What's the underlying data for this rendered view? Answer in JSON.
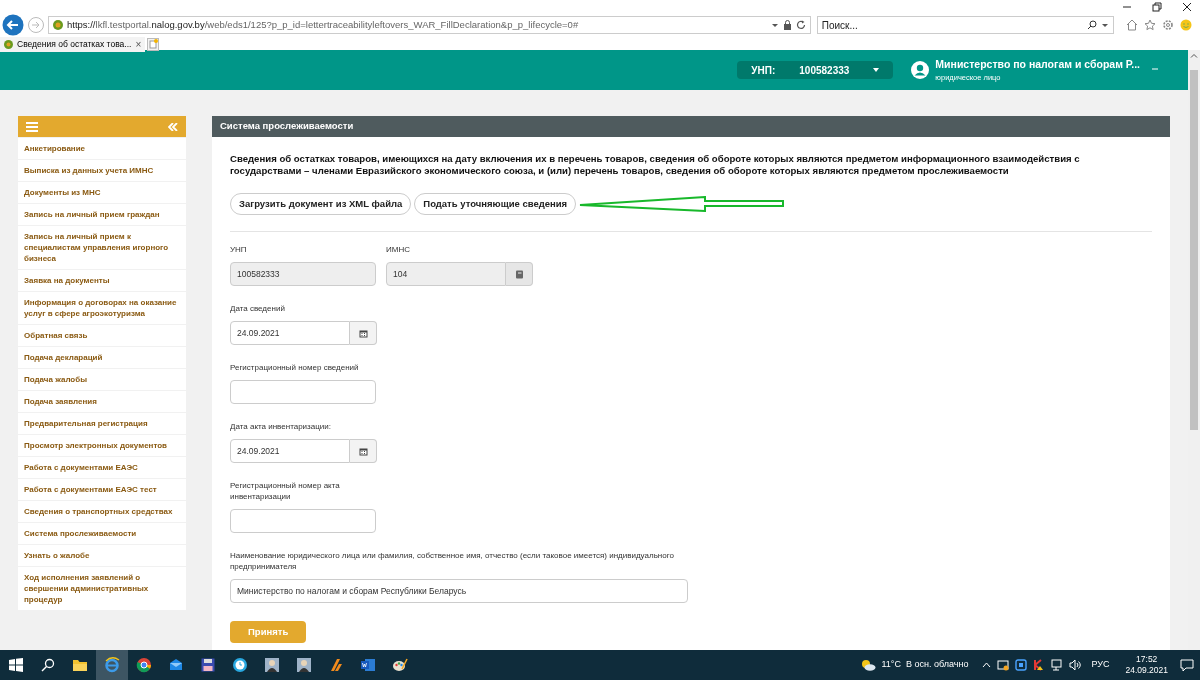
{
  "browser": {
    "url_scheme": "https://",
    "url_host_pre": "lkfl.testportal.",
    "url_host_main": "nalog.gov.by",
    "url_path": "/web/eds1/125?p_p_id=lettertraceabilityleftovers_WAR_FillDeclaration&p_p_lifecycle=0#",
    "search_placeholder": "Поиск...",
    "tab_title": "Сведения об остатках това...",
    "tab_close": "×"
  },
  "header": {
    "unp_label": "УНП:",
    "unp_value": "100582333",
    "user_name": "Министерство по налогам и сборам Р...",
    "user_role": "юридическое лицо"
  },
  "sidebar": {
    "items": [
      {
        "label": "Анкетирование",
        "selected": false
      },
      {
        "label": "Выписка из данных учета ИМНС",
        "selected": false
      },
      {
        "label": "Документы из МНС",
        "selected": false
      },
      {
        "label": "Запись на личный прием граждан",
        "selected": false
      },
      {
        "label": "Запись на личный прием к специалистам управления игорного бизнеса",
        "selected": false
      },
      {
        "label": "Заявка на документы",
        "selected": false
      },
      {
        "label": "Информация о договорах на оказание услуг в сфере агроэкотуризма",
        "selected": false
      },
      {
        "label": "Обратная связь",
        "selected": false
      },
      {
        "label": "Подача деклараций",
        "selected": false
      },
      {
        "label": "Подача жалобы",
        "selected": false
      },
      {
        "label": "Подача заявления",
        "selected": false
      },
      {
        "label": "Предварительная регистрация",
        "selected": false
      },
      {
        "label": "Просмотр электронных документов",
        "selected": false
      },
      {
        "label": "Работа с документами ЕАЭС",
        "selected": false
      },
      {
        "label": "Работа с документами ЕАЭС тест",
        "selected": false
      },
      {
        "label": "Сведения о транспортных средствах",
        "selected": false
      },
      {
        "label": "Система прослеживаемости",
        "selected": false
      },
      {
        "label": "Узнать о жалобе",
        "selected": false
      },
      {
        "label": "Ход исполнения заявлений о свершении административных процедур",
        "selected": false
      }
    ]
  },
  "panel": {
    "title": "Система прослеживаемости",
    "heading": "Сведения об остатках товаров, имеющихся на дату включения их в перечень товаров, сведения об обороте которых являются предметом информационного взаимодействия с государствами – членами Евразийского экономического союза, и (или) перечень товаров, сведения об обороте которых являются предметом прослеживаемости",
    "buttons": [
      "Загрузить документ из XML файла",
      "Подать уточняющие сведения"
    ],
    "fields": [
      {
        "kind": "pair",
        "items": [
          {
            "kind": "text",
            "label": "УНП",
            "value": "100582333",
            "disabled": true
          },
          {
            "kind": "lookup",
            "label": "ИМНС",
            "value": "104",
            "disabled": true
          }
        ]
      },
      {
        "kind": "date",
        "label": "Дата сведений",
        "value": "24.09.2021",
        "disabled": false
      },
      {
        "kind": "text",
        "label": "Регистрационный номер сведений",
        "disabled": false
      },
      {
        "kind": "date",
        "label": "Дата акта инвентаризации:",
        "value": "24.09.2021",
        "disabled": false
      },
      {
        "kind": "text",
        "label": "Регистрационный номер акта инвентаризации",
        "disabled": false
      },
      {
        "kind": "wide",
        "label": "Наименование юридического лица или фамилия, собственное имя, отчество (если таковое имеется) индивидуального предпринимателя",
        "value": "Министерство по налогам и сборам Республики Беларусь",
        "disabled": false
      }
    ],
    "submit": "Принять"
  },
  "taskbar": {
    "weather": "11°C  В осн. облачно",
    "language": "РУС",
    "time": "17:52",
    "date": "24.09.2021"
  }
}
